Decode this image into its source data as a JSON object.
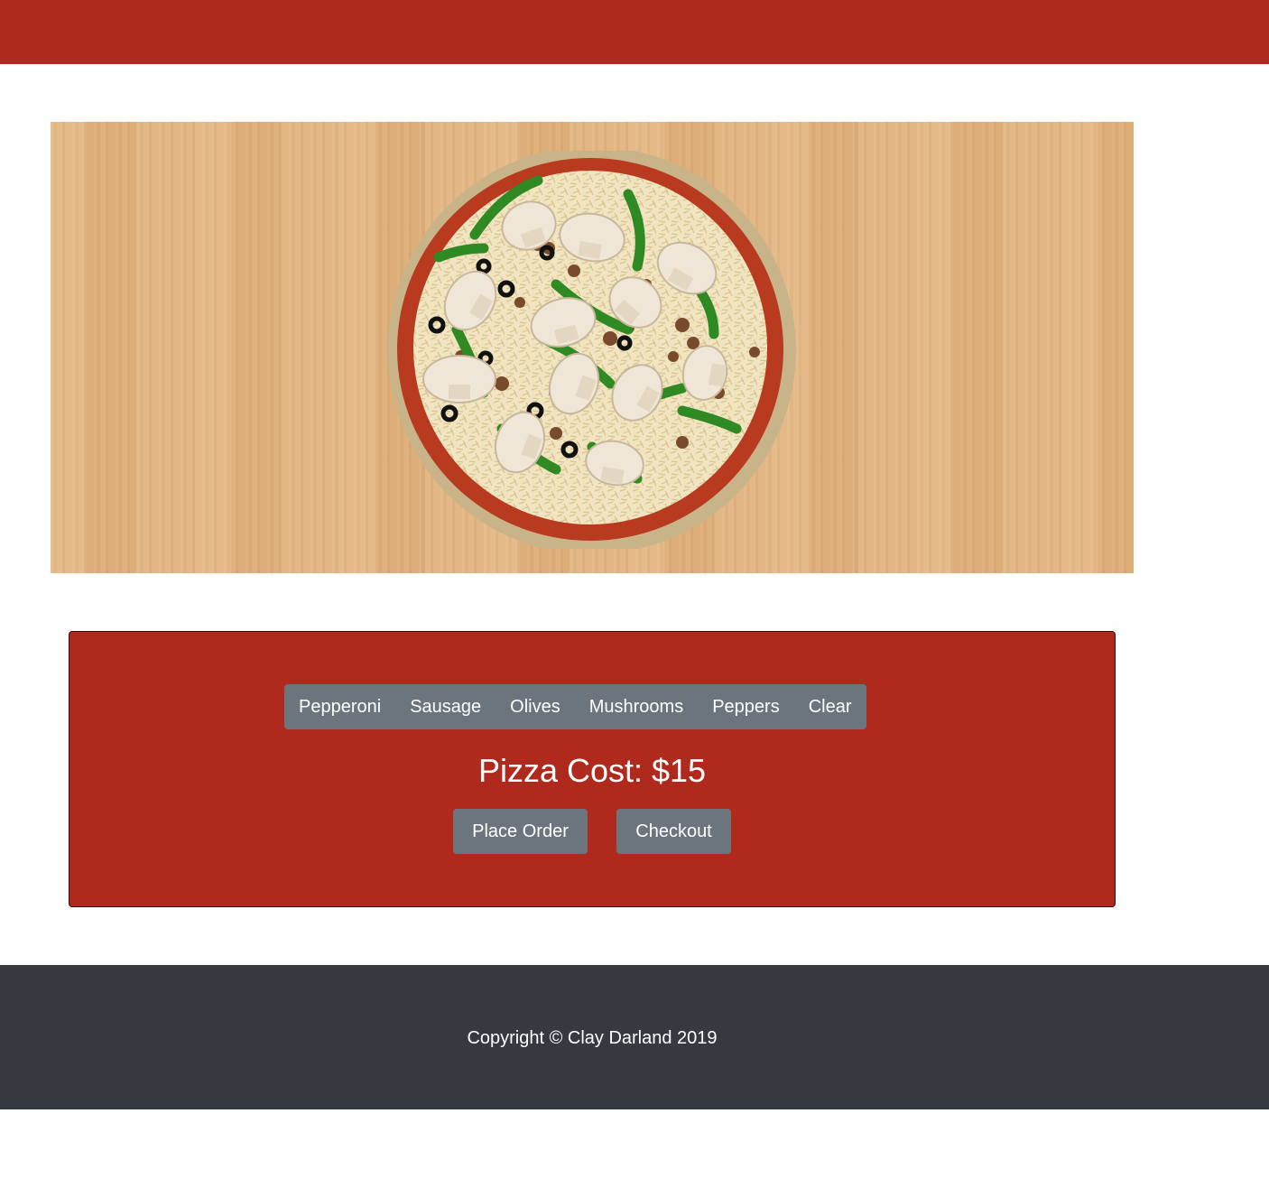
{
  "colors": {
    "brand_red": "#b0291d",
    "button_gray": "#6c757d",
    "footer_dark": "#343a40",
    "wood": "#e2b47f"
  },
  "hero": {
    "image_subject": "pizza-with-toppings"
  },
  "toppings": {
    "buttons": [
      "Pepperoni",
      "Sausage",
      "Olives",
      "Mushrooms",
      "Peppers",
      "Clear"
    ]
  },
  "order": {
    "cost_text": "Pizza Cost: $15",
    "place_order_label": "Place Order",
    "checkout_label": "Checkout"
  },
  "footer": {
    "copyright": "Copyright © Clay Darland 2019"
  }
}
